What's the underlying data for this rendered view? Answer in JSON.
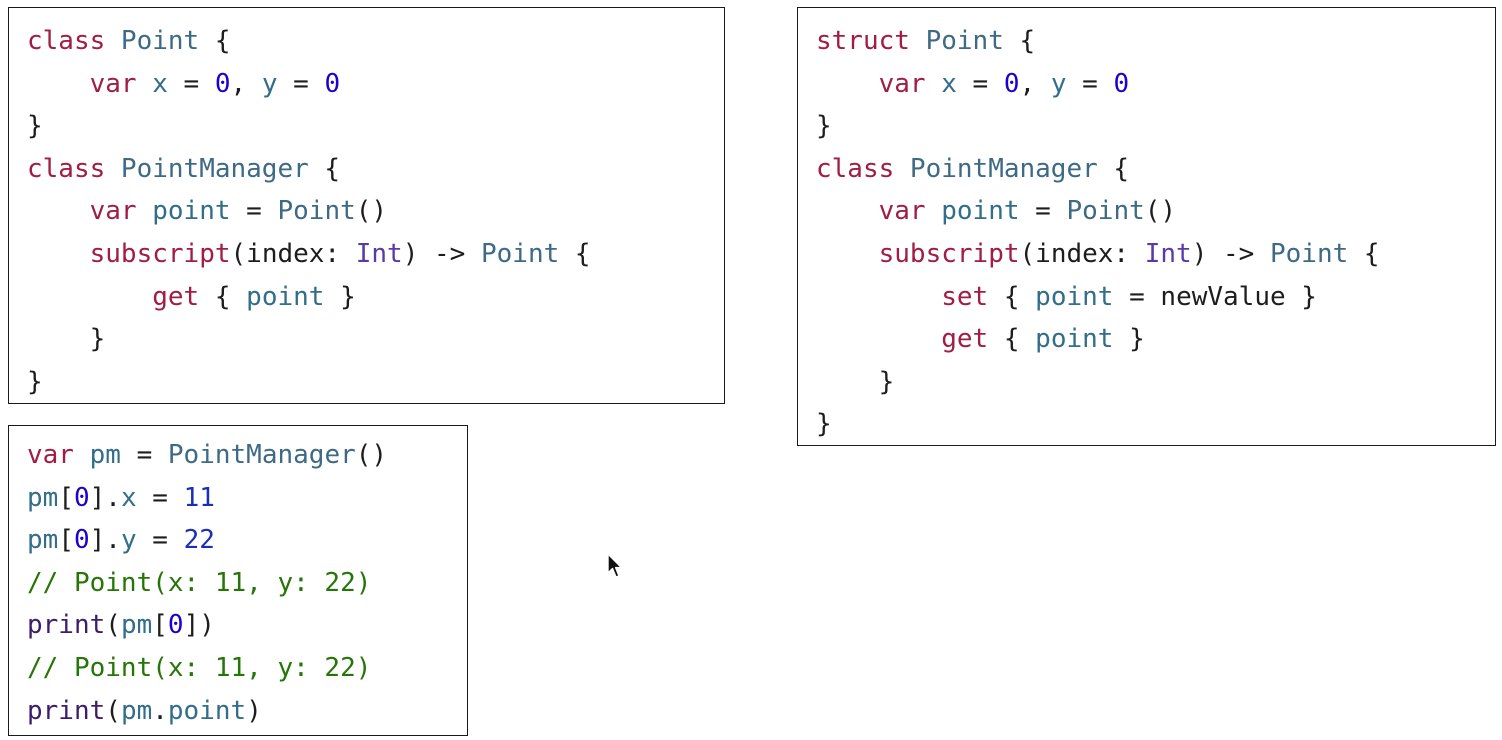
{
  "panels": {
    "class_example": {
      "lines": [
        [
          {
            "t": "class ",
            "c": "kw-deep"
          },
          {
            "t": "Point",
            "c": "type"
          },
          {
            "t": " {",
            "c": "plain"
          }
        ],
        [
          {
            "t": "    ",
            "c": "plain"
          },
          {
            "t": "var ",
            "c": "kw-deep"
          },
          {
            "t": "x",
            "c": "var"
          },
          {
            "t": " = ",
            "c": "plain"
          },
          {
            "t": "0",
            "c": "num"
          },
          {
            "t": ", ",
            "c": "plain"
          },
          {
            "t": "y",
            "c": "var"
          },
          {
            "t": " = ",
            "c": "plain"
          },
          {
            "t": "0",
            "c": "num"
          }
        ],
        [
          {
            "t": "}",
            "c": "plain"
          }
        ],
        [
          {
            "t": "class ",
            "c": "kw-deep"
          },
          {
            "t": "PointManager",
            "c": "type"
          },
          {
            "t": " {",
            "c": "plain"
          }
        ],
        [
          {
            "t": "    ",
            "c": "plain"
          },
          {
            "t": "var ",
            "c": "kw-deep"
          },
          {
            "t": "point",
            "c": "var"
          },
          {
            "t": " = ",
            "c": "plain"
          },
          {
            "t": "Point",
            "c": "type"
          },
          {
            "t": "()",
            "c": "plain"
          }
        ],
        [
          {
            "t": "    ",
            "c": "plain"
          },
          {
            "t": "subscript",
            "c": "kw-deep"
          },
          {
            "t": "(index: ",
            "c": "plain"
          },
          {
            "t": "Int",
            "c": "sys"
          },
          {
            "t": ") -> ",
            "c": "plain"
          },
          {
            "t": "Point",
            "c": "type"
          },
          {
            "t": " {",
            "c": "plain"
          }
        ],
        [
          {
            "t": "        ",
            "c": "plain"
          },
          {
            "t": "get",
            "c": "kw-deep"
          },
          {
            "t": " { ",
            "c": "plain"
          },
          {
            "t": "point",
            "c": "var"
          },
          {
            "t": " }",
            "c": "plain"
          }
        ],
        [
          {
            "t": "    }",
            "c": "plain"
          }
        ],
        [
          {
            "t": "}",
            "c": "plain"
          }
        ]
      ]
    },
    "struct_example": {
      "lines": [
        [
          {
            "t": "struct ",
            "c": "kw-deep"
          },
          {
            "t": "Point",
            "c": "type"
          },
          {
            "t": " {",
            "c": "plain"
          }
        ],
        [
          {
            "t": "    ",
            "c": "plain"
          },
          {
            "t": "var ",
            "c": "kw-deep"
          },
          {
            "t": "x",
            "c": "var"
          },
          {
            "t": " = ",
            "c": "plain"
          },
          {
            "t": "0",
            "c": "num"
          },
          {
            "t": ", ",
            "c": "plain"
          },
          {
            "t": "y",
            "c": "var"
          },
          {
            "t": " = ",
            "c": "plain"
          },
          {
            "t": "0",
            "c": "num"
          }
        ],
        [
          {
            "t": "}",
            "c": "plain"
          }
        ],
        [
          {
            "t": "class ",
            "c": "kw-deep"
          },
          {
            "t": "PointManager",
            "c": "type"
          },
          {
            "t": " {",
            "c": "plain"
          }
        ],
        [
          {
            "t": "    ",
            "c": "plain"
          },
          {
            "t": "var ",
            "c": "kw-deep"
          },
          {
            "t": "point",
            "c": "var"
          },
          {
            "t": " = ",
            "c": "plain"
          },
          {
            "t": "Point",
            "c": "type"
          },
          {
            "t": "()",
            "c": "plain"
          }
        ],
        [
          {
            "t": "    ",
            "c": "plain"
          },
          {
            "t": "subscript",
            "c": "kw-deep"
          },
          {
            "t": "(index: ",
            "c": "plain"
          },
          {
            "t": "Int",
            "c": "sys"
          },
          {
            "t": ") -> ",
            "c": "plain"
          },
          {
            "t": "Point",
            "c": "type"
          },
          {
            "t": " {",
            "c": "plain"
          }
        ],
        [
          {
            "t": "        ",
            "c": "plain"
          },
          {
            "t": "set",
            "c": "kw-deep"
          },
          {
            "t": " { ",
            "c": "plain"
          },
          {
            "t": "point",
            "c": "var"
          },
          {
            "t": " = newValue }",
            "c": "plain"
          }
        ],
        [
          {
            "t": "        ",
            "c": "plain"
          },
          {
            "t": "get",
            "c": "kw-deep"
          },
          {
            "t": " { ",
            "c": "plain"
          },
          {
            "t": "point",
            "c": "var"
          },
          {
            "t": " }",
            "c": "plain"
          }
        ],
        [
          {
            "t": "    }",
            "c": "plain"
          }
        ],
        [
          {
            "t": "}",
            "c": "plain"
          }
        ]
      ]
    },
    "usage_example": {
      "lines": [
        [
          {
            "t": "var ",
            "c": "kw-deep"
          },
          {
            "t": "pm",
            "c": "var"
          },
          {
            "t": " = ",
            "c": "plain"
          },
          {
            "t": "PointManager",
            "c": "type"
          },
          {
            "t": "()",
            "c": "plain"
          }
        ],
        [
          {
            "t": "pm",
            "c": "var"
          },
          {
            "t": "[",
            "c": "plain"
          },
          {
            "t": "0",
            "c": "num"
          },
          {
            "t": "].",
            "c": "plain"
          },
          {
            "t": "x",
            "c": "var"
          },
          {
            "t": " = ",
            "c": "plain"
          },
          {
            "t": "11",
            "c": "num2"
          }
        ],
        [
          {
            "t": "pm",
            "c": "var"
          },
          {
            "t": "[",
            "c": "plain"
          },
          {
            "t": "0",
            "c": "num"
          },
          {
            "t": "].",
            "c": "plain"
          },
          {
            "t": "y",
            "c": "var"
          },
          {
            "t": " = ",
            "c": "plain"
          },
          {
            "t": "22",
            "c": "num2"
          }
        ],
        [
          {
            "t": "// Point(x: 11, y: 22)",
            "c": "comment"
          }
        ],
        [
          {
            "t": "print",
            "c": "fn"
          },
          {
            "t": "(",
            "c": "plain"
          },
          {
            "t": "pm",
            "c": "var"
          },
          {
            "t": "[",
            "c": "plain"
          },
          {
            "t": "0",
            "c": "num"
          },
          {
            "t": "])",
            "c": "plain"
          }
        ],
        [
          {
            "t": "// Point(x: 11, y: 22)",
            "c": "comment"
          }
        ],
        [
          {
            "t": "print",
            "c": "fn"
          },
          {
            "t": "(",
            "c": "plain"
          },
          {
            "t": "pm",
            "c": "var"
          },
          {
            "t": ".",
            "c": "plain"
          },
          {
            "t": "point",
            "c": "var"
          },
          {
            "t": ")",
            "c": "plain"
          }
        ]
      ]
    }
  },
  "colors": {
    "keyword": "#a11d45",
    "type": "#3e6a86",
    "number": "#1c00cf",
    "comment": "#267507",
    "function": "#3b1f6e",
    "border": "#1a1a1a"
  },
  "cursor_icon": "arrow-pointer-icon"
}
